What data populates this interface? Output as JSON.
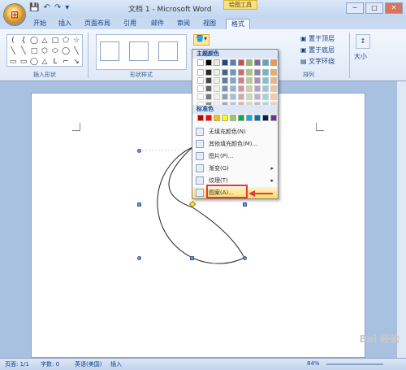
{
  "titlebar": {
    "doc_title": "文档 1 - Microsoft Word",
    "context_tab": "绘图工具",
    "qat": [
      "💾",
      "↶",
      "↷",
      "▾"
    ],
    "controls": {
      "min": "─",
      "max": "□",
      "close": "✕"
    }
  },
  "tabs": [
    "开始",
    "插入",
    "页面布局",
    "引用",
    "邮件",
    "审阅",
    "视图",
    "格式"
  ],
  "ribbon": {
    "group_insert_shapes": "插入形状",
    "group_shape_styles": "形状样式",
    "group_arrange": "排列",
    "bring_front": "置于顶层",
    "send_back": "置于底层",
    "text_wrap": "文字环绕",
    "size": "大小",
    "style_colors": [
      "#000000",
      "#4f81bd",
      "#c0504d"
    ],
    "shapes": [
      "(",
      "{",
      "◯",
      "△",
      "□",
      "⬠",
      "☆",
      "╲",
      "╲",
      "□",
      "⬡",
      "⬭",
      "◯",
      "╲",
      "▭",
      "▭",
      "◯",
      "△",
      "L",
      "⌐",
      "↘"
    ]
  },
  "dropdown": {
    "theme_colors_label": "主题颜色",
    "standard_colors_label": "标准色",
    "theme_top": [
      "#ffffff",
      "#000000",
      "#eeece1",
      "#1f497d",
      "#4f81bd",
      "#c0504d",
      "#9bbb59",
      "#8064a2",
      "#4bacc6",
      "#f79646"
    ],
    "standard": [
      "#c00000",
      "#ff0000",
      "#ffc000",
      "#ffff00",
      "#92d050",
      "#00b050",
      "#00b0f0",
      "#0070c0",
      "#002060",
      "#7030a0"
    ],
    "items": [
      {
        "label": "无填充颜色(N)",
        "has_arrow": false
      },
      {
        "label": "其他填充颜色(M)...",
        "has_arrow": false
      },
      {
        "label": "图片(P)...",
        "has_arrow": false
      },
      {
        "label": "渐变(G)",
        "has_arrow": true
      },
      {
        "label": "纹理(T)",
        "has_arrow": true
      },
      {
        "label": "图案(A)...",
        "has_arrow": false
      }
    ]
  },
  "status": {
    "page": "页面: 1/1",
    "words": "字数: 0",
    "lang": "英语(美国)",
    "mode": "插入",
    "zoom": "84%"
  },
  "watermark": "Bai 经验"
}
